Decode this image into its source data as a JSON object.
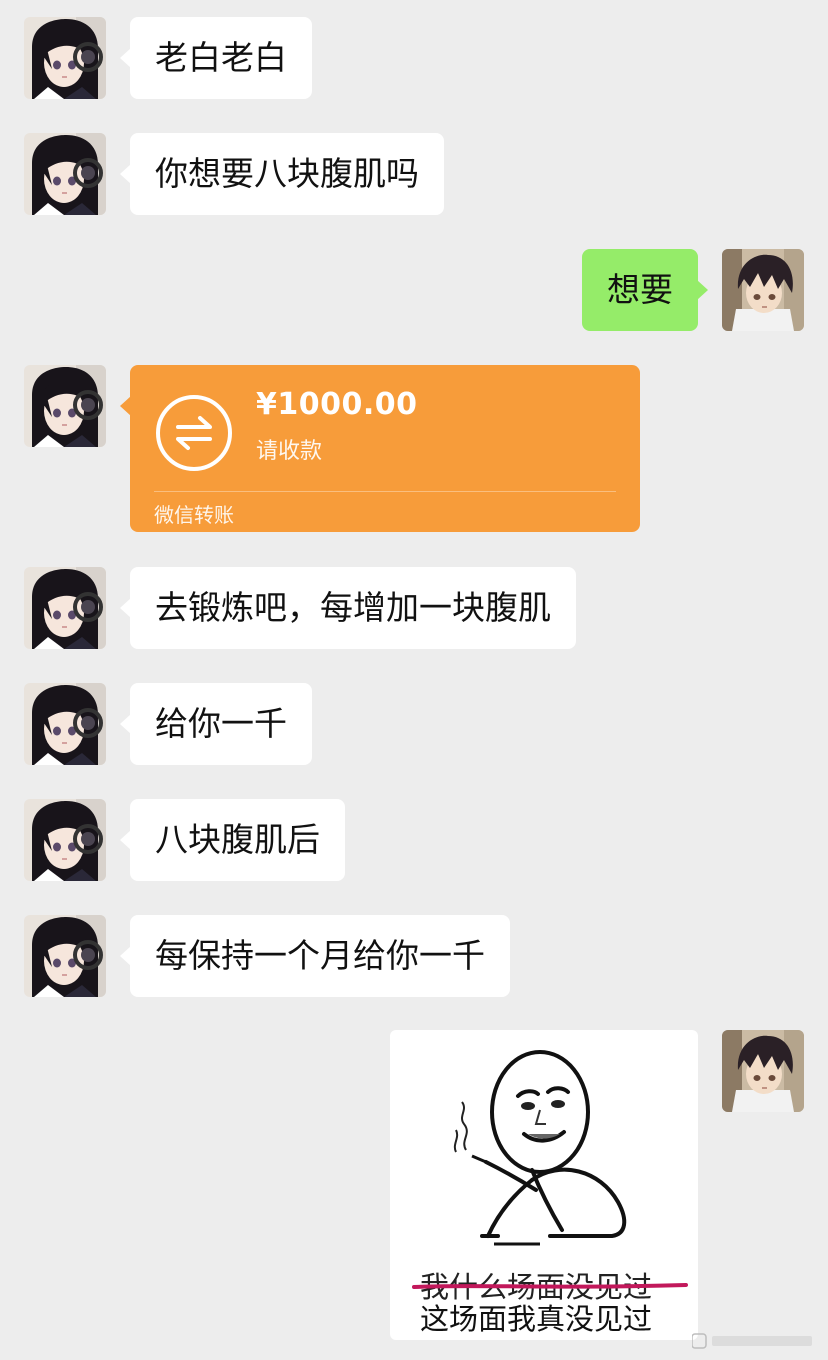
{
  "chat": {
    "messages": [
      {
        "text": "老白老白"
      },
      {
        "text": "你想要八块腹肌吗"
      },
      {
        "text": "想要"
      },
      {
        "text": "去锻炼吧，每增加一块腹肌"
      },
      {
        "text": "给你一千"
      },
      {
        "text": "八块腹肌后"
      },
      {
        "text": "每保持一个月给你一千"
      }
    ],
    "transfer": {
      "amount": "¥1000.00",
      "status": "请收款",
      "footer": "微信转账",
      "icon": "transfer-arrows-icon"
    },
    "sticker": {
      "icon": "panda-man-smoking-meme",
      "line1": "我什么场面没见过",
      "line2": "这场面我真没见过"
    }
  },
  "colors": {
    "background": "#ededed",
    "incoming_bubble": "#ffffff",
    "outgoing_bubble": "#95ec69",
    "transfer_card": "#f79c3a",
    "strikethrough": "#c2185b"
  }
}
